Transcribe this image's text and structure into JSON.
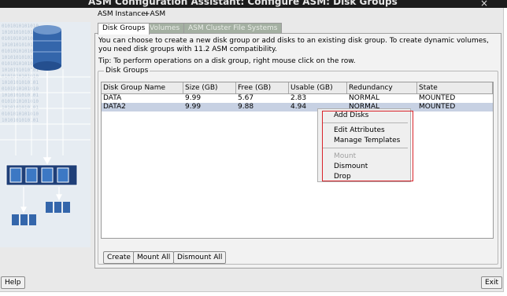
{
  "window": {
    "title": "ASM Configuration Assistant: Configure ASM: Disk Groups",
    "close_glyph": "×"
  },
  "asm_instance": {
    "label": "ASM Instance:",
    "value": "+ASM"
  },
  "tabs": [
    {
      "label": "Disk Groups",
      "active": true
    },
    {
      "label": "Volumes",
      "active": false
    },
    {
      "label": "ASM Cluster File Systems",
      "active": false
    }
  ],
  "description": "You can choose to create a new disk group or add disks to an existing disk group. To create dynamic volumes, you need disk groups with 11.2 ASM compatibility.",
  "tip": "Tip: To perform operations on a disk group, right mouse click on the row.",
  "disk_groups": {
    "title": "Disk Groups",
    "columns": [
      "Disk Group Name",
      "Size (GB)",
      "Free (GB)",
      "Usable (GB)",
      "Redundancy",
      "State"
    ],
    "rows": [
      [
        "DATA",
        "9.99",
        "5.67",
        "2.83",
        "NORMAL",
        "MOUNTED"
      ],
      [
        "DATA2",
        "9.99",
        "9.88",
        "4.94",
        "NORMAL",
        "MOUNTED"
      ]
    ]
  },
  "context_menu": {
    "items": [
      {
        "label": "Add Disks",
        "enabled": true
      },
      {
        "label": "Edit Attributes",
        "enabled": true
      },
      {
        "label": "Manage Templates",
        "enabled": true
      },
      {
        "label": "Mount",
        "enabled": false
      },
      {
        "label": "Dismount",
        "enabled": true
      },
      {
        "label": "Drop",
        "enabled": true
      }
    ]
  },
  "buttons": {
    "create": "Create",
    "mount_all": "Mount All",
    "dismount_all": "Dismount All",
    "help": "Help",
    "exit": "Exit"
  },
  "colors": {
    "selected_row": "#c7d1e3",
    "highlight_box": "#d9232a",
    "inactive_tab": "#a4b0a2",
    "illustration_blue": "#2f63a8"
  },
  "icons": [
    "database-cylinder-icon",
    "disk-array-icon",
    "disk-icon",
    "arrow-down-icon"
  ]
}
